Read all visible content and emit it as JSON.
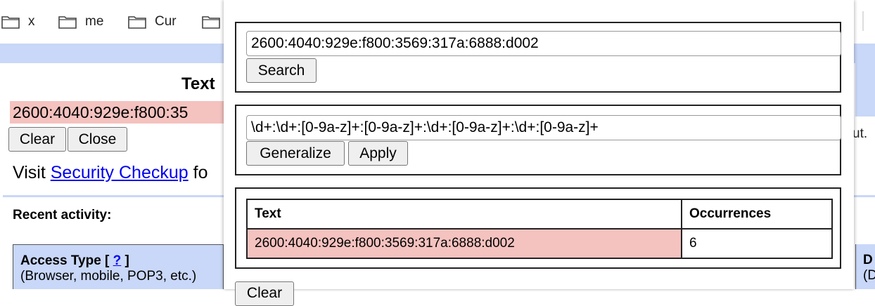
{
  "bookmarks": [
    {
      "label": "x",
      "icon": "folder-icon"
    },
    {
      "label": "me",
      "icon": "folder-icon"
    },
    {
      "label": "Cur",
      "icon": "folder-icon"
    },
    {
      "label": "",
      "icon": "folder-icon"
    }
  ],
  "background": {
    "heading_partial": "Text",
    "highlighted_value_partial": "2600:4040:929e:f800:35",
    "clear_label": "Clear",
    "close_label": "Close",
    "visit_prefix": "Visit ",
    "security_link": "Security Checkup",
    "visit_suffix_partial": " fo",
    "right_cut_text": "ut.",
    "recent_activity": "Recent activity:",
    "access_type_label": "Access Type [ ",
    "access_type_help": "?",
    "access_type_close": " ]",
    "access_type_desc": "(Browser, mobile, POP3, etc.)",
    "right_col_head": "D",
    "right_col_sub": "(D"
  },
  "popup": {
    "search_value": "2600:4040:929e:f800:3569:317a:6888:d002",
    "search_button": "Search",
    "pattern_value": "\\d+:\\d+:[0-9a-z]+:[0-9a-z]+:\\d+:[0-9a-z]+:\\d+:[0-9a-z]+",
    "generalize_button": "Generalize",
    "apply_button": "Apply",
    "table": {
      "col_text": "Text",
      "col_occurrences": "Occurrences",
      "rows": [
        {
          "text": "2600:4040:929e:f800:3569:317a:6888:d002",
          "occurrences": "6"
        }
      ]
    },
    "bottom_button_partial": "Clear"
  },
  "colors": {
    "accent_blue": "#c9d7f8",
    "highlight_pink": "#f4c2bf",
    "link_blue": "#0000ee"
  }
}
